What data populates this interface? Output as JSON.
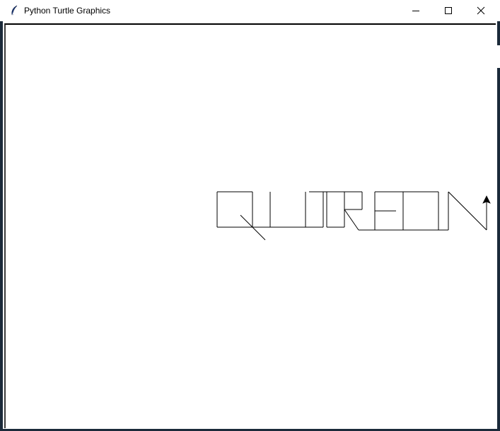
{
  "window": {
    "title": "Python Turtle Graphics",
    "app_icon": "feather-icon",
    "controls": {
      "minimize_icon": "minimize-icon",
      "maximize_icon": "maximize-icon",
      "close_icon": "close-icon"
    }
  },
  "canvas": {
    "background": "#ffffff",
    "pen_color": "#000000",
    "drawing": {
      "description_letters": [
        "Q",
        "U",
        "I",
        "T",
        "R",
        "E",
        "O",
        "N"
      ],
      "turtle_cursor": "arrow-cursor-icon",
      "turtle_heading": "up"
    }
  }
}
